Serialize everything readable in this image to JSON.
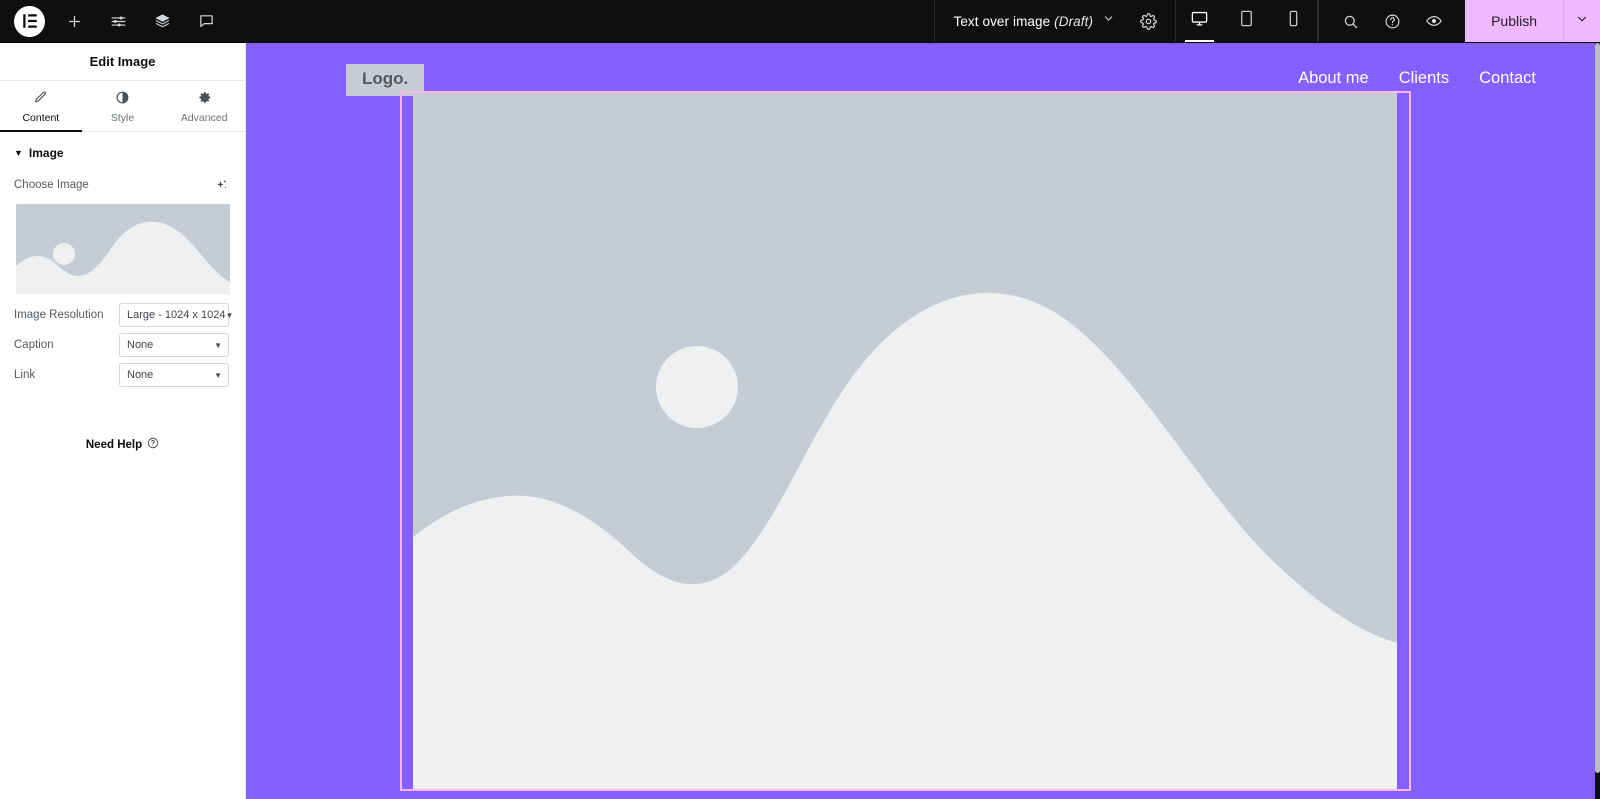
{
  "topbar": {
    "logo_icon": "elementor-logo-icon",
    "left_icons": [
      {
        "name": "add-element-icon",
        "glyph": "plus"
      },
      {
        "name": "site-settings-sliders-icon",
        "glyph": "sliders"
      },
      {
        "name": "structure-layers-icon",
        "glyph": "layers"
      },
      {
        "name": "notes-comment-icon",
        "glyph": "comment"
      }
    ],
    "document_title": "Text over image",
    "document_status": "(Draft)",
    "title_chevron_icon": "chevron-down-icon",
    "settings_icon": "gear-icon",
    "devices": [
      {
        "name": "desktop",
        "icon": "desktop-icon",
        "active": true
      },
      {
        "name": "tablet",
        "icon": "tablet-icon",
        "active": false
      },
      {
        "name": "mobile",
        "icon": "mobile-icon",
        "active": false
      }
    ],
    "right_icons": [
      {
        "name": "search-icon",
        "glyph": "magnifier"
      },
      {
        "name": "help-icon",
        "glyph": "question-circle"
      },
      {
        "name": "preview-icon",
        "glyph": "eye"
      }
    ],
    "publish_label": "Publish",
    "publish_caret_icon": "chevron-down-icon",
    "publish_color": "#f0b9ff"
  },
  "panel": {
    "title": "Edit Image",
    "tabs": [
      {
        "label": "Content",
        "icon": "pencil-icon",
        "active": true
      },
      {
        "label": "Style",
        "icon": "contrast-circle-icon",
        "active": false
      },
      {
        "label": "Advanced",
        "icon": "gear-icon",
        "active": false
      }
    ],
    "section": {
      "title": "Image",
      "caret_icon": "caret-down-icon"
    },
    "choose_image": {
      "label": "Choose Image",
      "ai_icon": "ai-sparkle-icon"
    },
    "controls": [
      {
        "label": "Image Resolution",
        "value": "Large - 1024 x 1024",
        "caret_icon": "chevron-down-icon"
      },
      {
        "label": "Caption",
        "value": "None",
        "caret_icon": "chevron-down-icon"
      },
      {
        "label": "Link",
        "value": "None",
        "caret_icon": "chevron-down-icon"
      }
    ],
    "need_help": {
      "label": "Need Help",
      "icon": "question-circle-icon"
    },
    "collapse_icon": "chevron-left-icon"
  },
  "canvas": {
    "background_color": "#855fff",
    "logo_text": "Logo.",
    "logo_bg": "#c9cbd2",
    "nav_items": [
      {
        "label": "About me"
      },
      {
        "label": "Clients"
      },
      {
        "label": "Contact"
      }
    ],
    "selected_widget": {
      "name": "image-widget",
      "outline_color": "#f5b8f0"
    },
    "placeholder_image": {
      "name": "image-placeholder",
      "bg_color": "#c6ccd3",
      "shape_color": "#f0f1f3"
    }
  }
}
